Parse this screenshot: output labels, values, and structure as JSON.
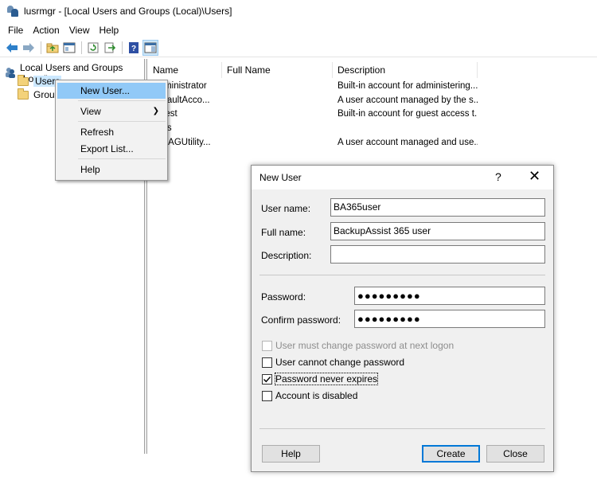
{
  "window": {
    "title": "lusrmgr - [Local Users and Groups (Local)\\Users]"
  },
  "menubar": {
    "items": [
      "File",
      "Action",
      "View",
      "Help"
    ]
  },
  "toolbar": {
    "icons": [
      "back-arrow-icon",
      "forward-arrow-icon",
      "up-folder-icon",
      "show-hide-tree-icon",
      "refresh-icon",
      "export-list-icon",
      "help-icon",
      "properties-pane-icon"
    ]
  },
  "tree": {
    "root": "Local Users and Groups (Local)",
    "children": [
      "Users",
      "Groups"
    ]
  },
  "list": {
    "columns": [
      "Name",
      "Full Name",
      "Description"
    ],
    "rows": [
      {
        "name": "Administrator",
        "full_name": "",
        "description": "Built-in account for administering..."
      },
      {
        "name": "DefaultAcco...",
        "full_name": "",
        "description": "A user account managed by the s..."
      },
      {
        "name": "Guest",
        "full_name": "",
        "description": "Built-in account for guest access t..."
      },
      {
        "name": "linus",
        "full_name": "",
        "description": ""
      },
      {
        "name": "WDAGUtility...",
        "full_name": "",
        "description": "A user account managed and use..."
      }
    ]
  },
  "context_menu": {
    "items": [
      "New User...",
      "View",
      "Refresh",
      "Export List...",
      "Help"
    ],
    "highlighted": "New User..."
  },
  "dialog": {
    "title": "New User",
    "help_glyph": "?",
    "close_glyph": "✕",
    "user_name_label": "User name:",
    "user_name_value": "BA365user",
    "full_name_label": "Full name:",
    "full_name_value": "BackupAssist 365 user",
    "description_label": "Description:",
    "description_value": "",
    "password_label": "Password:",
    "password_value": "●●●●●●●●●",
    "confirm_label": "Confirm password:",
    "confirm_value": "●●●●●●●●●",
    "options": [
      {
        "label": "User must change password at next logon",
        "checked": false,
        "disabled": true
      },
      {
        "label": "User cannot change password",
        "checked": false,
        "disabled": false
      },
      {
        "label": "Password never expires",
        "checked": true,
        "disabled": false
      },
      {
        "label": "Account is disabled",
        "checked": false,
        "disabled": false
      }
    ],
    "buttons": {
      "help": "Help",
      "create": "Create",
      "close": "Close"
    }
  }
}
